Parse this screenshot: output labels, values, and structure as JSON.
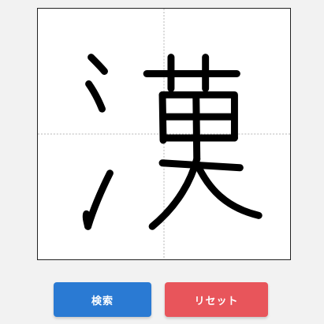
{
  "drawing_canvas": {
    "guide_line_color": "#b5b5b5",
    "stroke_color": "#000000",
    "background_color": "#ffffff"
  },
  "buttons": {
    "search_label": "検索",
    "search_color": "#2a7ad3",
    "reset_label": "リセット",
    "reset_color": "#e8555b"
  }
}
